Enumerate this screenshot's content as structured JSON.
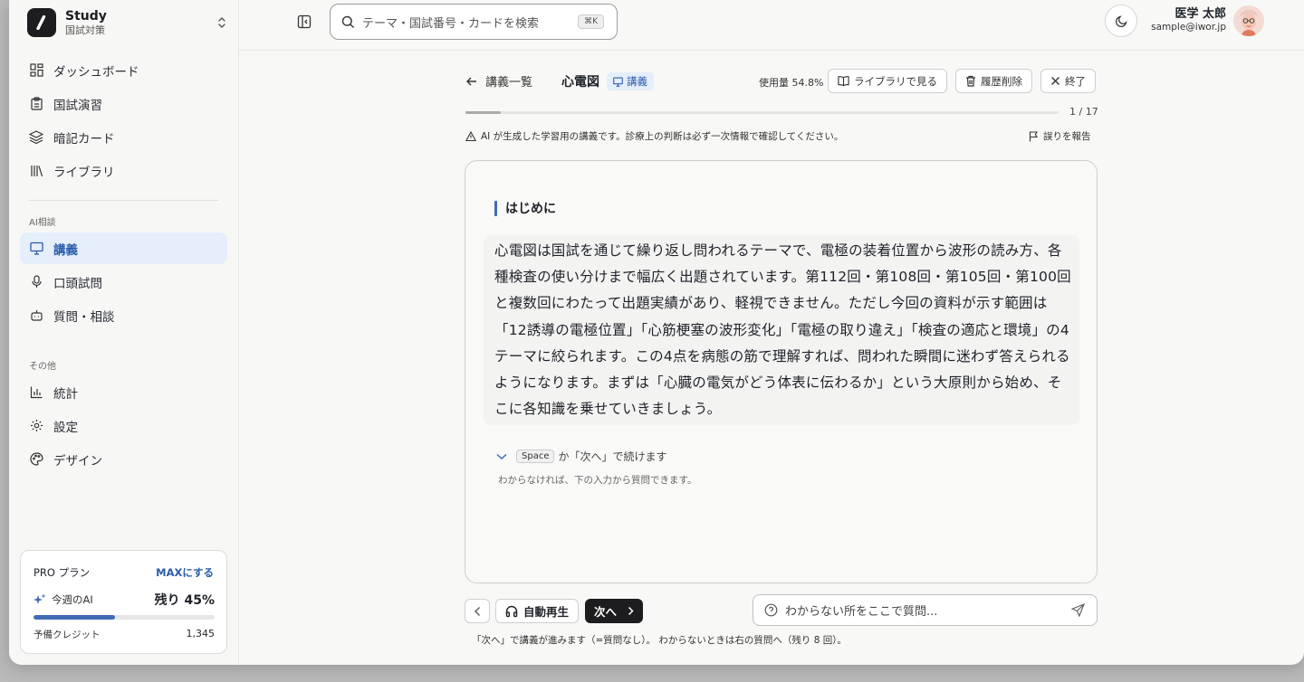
{
  "brand": {
    "name": "Study",
    "subtitle": "国試対策"
  },
  "nav": {
    "main": [
      {
        "label": "ダッシュボード",
        "icon": "dashboard-icon"
      },
      {
        "label": "国試演習",
        "icon": "clipboard-icon"
      },
      {
        "label": "暗記カード",
        "icon": "layers-icon"
      },
      {
        "label": "ライブラリ",
        "icon": "library-icon"
      }
    ],
    "ai_section_label": "AI相談",
    "ai": [
      {
        "label": "講義",
        "icon": "presentation-icon",
        "active": true
      },
      {
        "label": "口頭試問",
        "icon": "microphone-icon"
      },
      {
        "label": "質問・相談",
        "icon": "bot-icon"
      }
    ],
    "other_section_label": "その他",
    "other": [
      {
        "label": "統計",
        "icon": "chart-icon"
      },
      {
        "label": "設定",
        "icon": "gear-icon"
      },
      {
        "label": "デザイン",
        "icon": "palette-icon"
      }
    ]
  },
  "plan": {
    "title": "PRO プラン",
    "upgrade_label": "MAXにする",
    "ai_label": "今週のAI",
    "remaining_text": "残り 45%",
    "usage_fraction": 0.45,
    "credit_label": "予備クレジット",
    "credit_value": "1,345",
    "accent": "#3f6cb4"
  },
  "topbar": {
    "search_placeholder": "テーマ・国試番号・カードを検索",
    "search_shortcut": "⌘K",
    "user_name": "医学 太郎",
    "user_email": "sample@iwor.jp"
  },
  "lecture": {
    "back_label": "講義一覧",
    "title": "心電図",
    "badge": "講義",
    "usage": "使用量 54.8%",
    "library_button": "ライブラリで見る",
    "clear_history_button": "履歴削除",
    "end_button": "終了",
    "progress_text": "1 / 17",
    "progress_fraction": 0.0588,
    "disclaimer": "AI が生成した学習用の講義です。診療上の判断は必ず一次情報で確認してください。",
    "report_label": "誤りを報告",
    "section_heading": "はじめに",
    "paragraph": "心電図は国試を通じて繰り返し問われるテーマで、電極の装着位置から波形の読み方、各種検査の使い分けまで幅広く出題されています。第112回・第108回・第105回・第100回と複数回にわたって出題実績があり、軽視できません。ただし今回の資料が示す範囲は「12誘導の電極位置」「心筋梗塞の波形変化」「電極の取り違え」「検査の適応と環境」の4テーマに絞られます。この4点を病態の筋で理解すれば、問われた瞬間に迷わず答えられるようになります。まずは「心臓の電気がどう体表に伝わるか」という大原則から始め、そこに各知識を乗せていきましょう。",
    "continue_key": "Space",
    "continue_text": "か「次へ」で続けます",
    "continue_sub": "わからなければ、下の入力から質問できます。"
  },
  "controls": {
    "auto_play": "自動再生",
    "next": "次へ",
    "ask_placeholder": "わからない所をここで質問...",
    "note": "「次へ」で講義が進みます（=質問なし）。 わからないときは右の質問へ（残り 8 回）。"
  }
}
